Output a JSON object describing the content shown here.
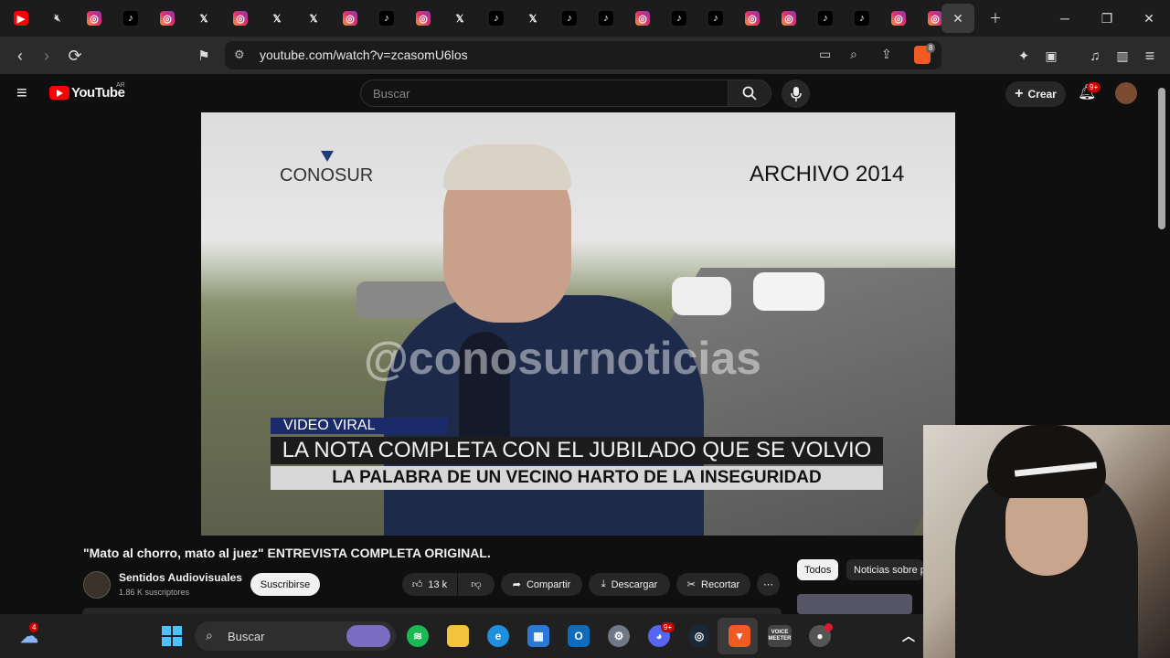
{
  "browser": {
    "tabs": [
      "youtube-icon",
      "mute-icon",
      "instagram-icon",
      "tiktok-icon",
      "instagram-icon",
      "x-icon",
      "instagram-icon",
      "x-icon",
      "x-icon",
      "instagram-icon",
      "tiktok-icon",
      "instagram-icon",
      "x-icon",
      "tiktok-icon",
      "x-icon",
      "tiktok-icon",
      "tiktok-icon",
      "instagram-icon",
      "tiktok-icon",
      "tiktok-icon",
      "instagram-icon",
      "instagram-icon",
      "tiktok-icon",
      "tiktok-icon",
      "instagram-icon",
      "instagram-icon"
    ],
    "url": "youtube.com/watch?v=zcasomU6los",
    "brave_badge": "8"
  },
  "youtube": {
    "logo_text": "YouTube",
    "region": "AR",
    "search_placeholder": "Buscar",
    "create_label": "Crear",
    "notif_count": "9+"
  },
  "video": {
    "brand": "CONOSUR",
    "archive_label": "ARCHIVO 2014",
    "watermark": "@conosurnoticias",
    "tag": "VIDEO VIRAL",
    "headline": "LA NOTA COMPLETA CON EL JUBILADO QUE SE VOLVIO VIRAL",
    "subline": "LA PALABRA DE UN VECINO HARTO DE LA INSEGURIDAD"
  },
  "meta": {
    "title": "\"Mato al chorro, mato al juez\" ENTREVISTA COMPLETA ORIGINAL.",
    "channel": "Sentidos Audiovisuales",
    "subscribers": "1.86 K suscriptores",
    "subscribe_label": "Suscribirse",
    "likes": "13 k",
    "share_label": "Compartir",
    "download_label": "Descargar",
    "clip_label": "Recortar",
    "chips": [
      "Todos",
      "Noticias sobre p"
    ]
  },
  "taskbar": {
    "weather_badge": "4",
    "search_label": "Buscar",
    "discord_badge": "9+",
    "voicemeeter_label": "VOICE MEETER"
  }
}
